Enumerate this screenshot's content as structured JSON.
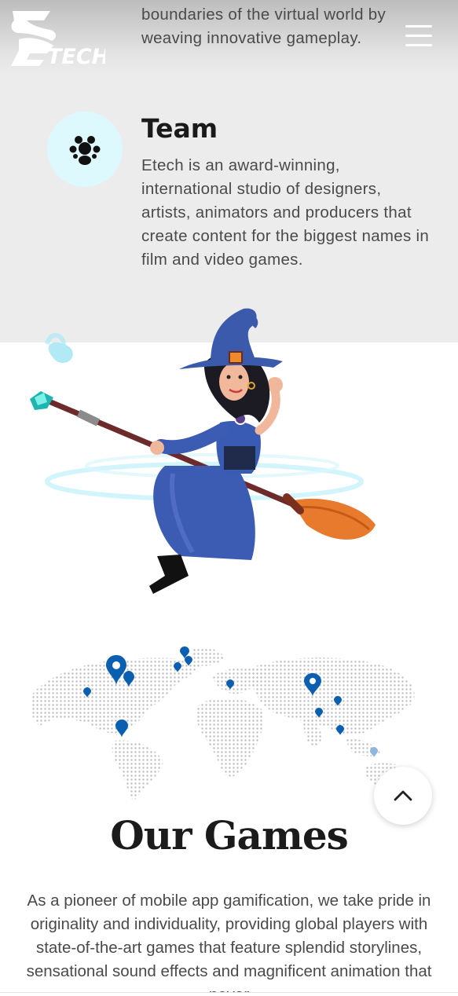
{
  "header": {
    "logo_text": "ETECH",
    "menu_icon": "hamburger-menu-icon"
  },
  "about": {
    "previous_text": "boundaries of the virtual world by weaving innovative gameplay.",
    "team": {
      "icon": "team-paw-icon",
      "title": "Team",
      "description": "Etech is an award-winning, international studio of designers, artists, animators and producers that create content for the biggest names in film and video games."
    }
  },
  "illustration": {
    "witch_icon": "witch-on-broom-illustration",
    "map_icon": "world-map-with-pins"
  },
  "games": {
    "title": "Our Games",
    "description": "As a pioneer of mobile app gamification, we take pride in originality and individuality, providing global players with state-of-the-art games that feature splendid storylines, sensational sound effects and magnificent animation that never"
  },
  "scroll_top": {
    "icon": "chevron-up-icon"
  },
  "colors": {
    "band": "#ececec",
    "icon_circle": "#ddf9fd",
    "pin": "#0b5fb0",
    "witch_dress": "#3c5cb4"
  }
}
